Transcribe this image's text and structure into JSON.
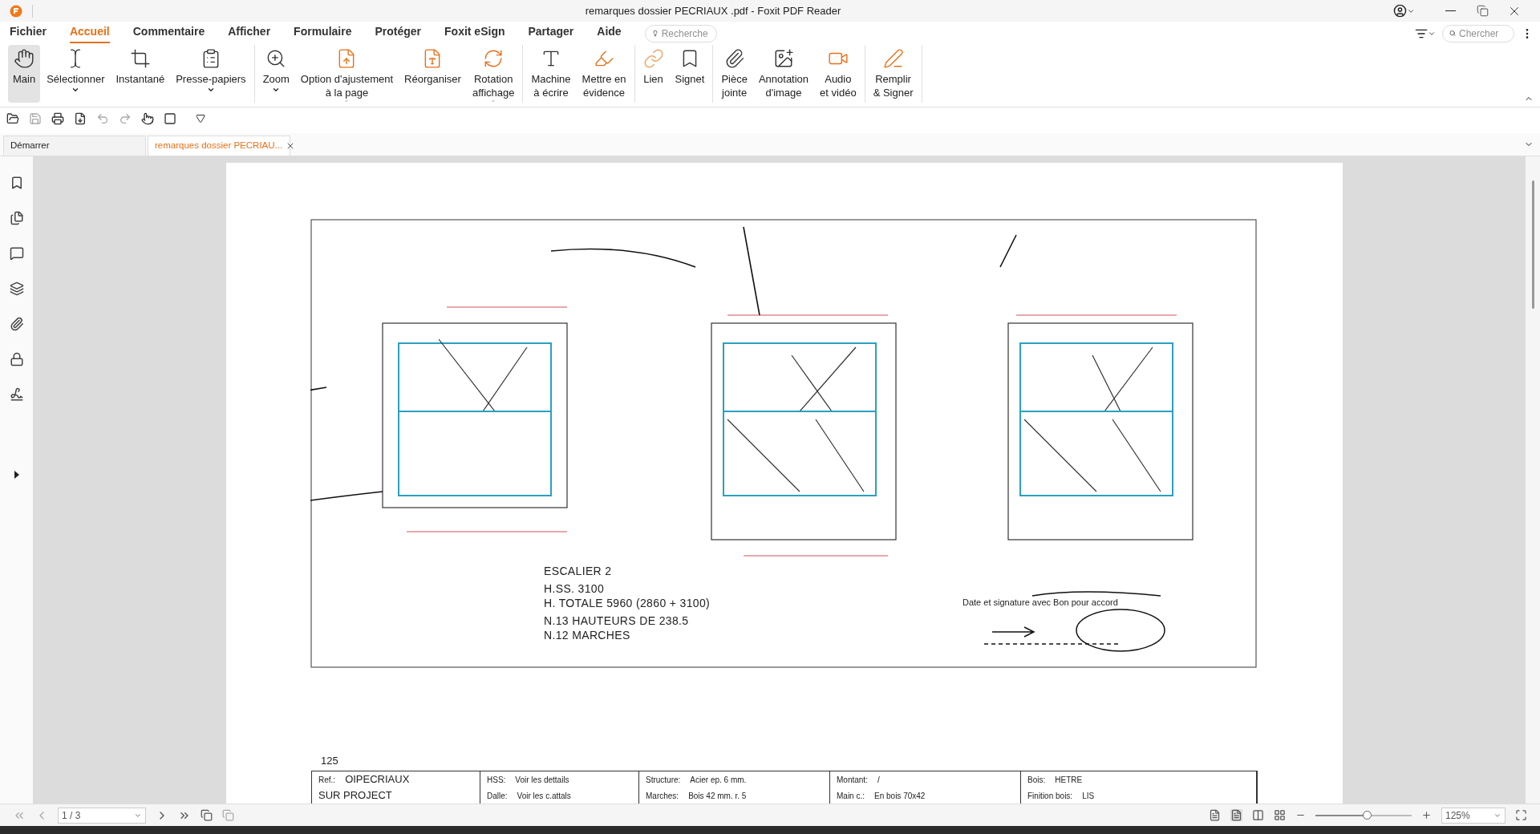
{
  "window": {
    "title": "remarques dossier PECRIAUX .pdf - Foxit PDF Reader"
  },
  "menu": [
    {
      "label": "Fichier",
      "selected": false
    },
    {
      "label": "Accueil",
      "selected": true
    },
    {
      "label": "Commentaire",
      "selected": false
    },
    {
      "label": "Afficher",
      "selected": false
    },
    {
      "label": "Formulaire",
      "selected": false
    },
    {
      "label": "Protéger",
      "selected": false
    },
    {
      "label": "Foxit eSign",
      "selected": false
    },
    {
      "label": "Partager",
      "selected": false
    },
    {
      "label": "Aide",
      "selected": false
    }
  ],
  "menu_search": {
    "placeholder": "Recherche"
  },
  "find": {
    "placeholder": "Chercher"
  },
  "ribbon": [
    [
      {
        "lines": [
          "Main"
        ],
        "selected": true,
        "dropdown": false
      },
      {
        "lines": [
          "Sélectionner"
        ],
        "selected": false,
        "dropdown": true
      },
      {
        "lines": [
          "Instantané"
        ],
        "selected": false,
        "dropdown": false
      },
      {
        "lines": [
          "Presse-papiers"
        ],
        "selected": false,
        "dropdown": true
      }
    ],
    [
      {
        "lines": [
          "Zoom"
        ],
        "selected": false,
        "dropdown": true
      },
      {
        "lines": [
          "Option d'ajustement",
          "à la page"
        ],
        "selected": false,
        "dropdown": true
      },
      {
        "lines": [
          "Réorganiser"
        ],
        "selected": false,
        "dropdown": false
      },
      {
        "lines": [
          "Rotation",
          "affichage"
        ],
        "selected": false,
        "dropdown": true
      }
    ],
    [
      {
        "lines": [
          "Machine",
          "à écrire"
        ],
        "selected": false,
        "dropdown": false
      },
      {
        "lines": [
          "Mettre en",
          "évidence"
        ],
        "selected": false,
        "dropdown": false
      }
    ],
    [
      {
        "lines": [
          "Lien"
        ],
        "selected": false,
        "dropdown": false
      },
      {
        "lines": [
          "Signet"
        ],
        "selected": false,
        "dropdown": false
      }
    ],
    [
      {
        "lines": [
          "Pièce",
          "jointe"
        ],
        "selected": false,
        "dropdown": false
      },
      {
        "lines": [
          "Annotation",
          "d'image"
        ],
        "selected": false,
        "dropdown": false
      },
      {
        "lines": [
          "Audio",
          "et vidéo"
        ],
        "selected": false,
        "dropdown": false
      }
    ],
    [
      {
        "lines": [
          "Remplir",
          "& Signer"
        ],
        "selected": false,
        "dropdown": false
      }
    ]
  ],
  "doc_tabs": [
    {
      "label": "Démarrer",
      "selected": false,
      "closable": false
    },
    {
      "label": "remarques dossier PECRIAU...",
      "selected": true,
      "closable": true
    }
  ],
  "page": {
    "notes": [
      "ESCALIER 2",
      "H.SS. 3100",
      "H. TOTALE 5960 (2860 + 3100)",
      "N.13 HAUTEURS DE 238.5",
      "N.12 MARCHES"
    ],
    "signature_label": "Date et signature avec Bon pour accord",
    "sheet_code": "125",
    "title_block": [
      {
        "label": "Ref.:",
        "value": "OIPECRIAUX"
      },
      {
        "label": "HSS:",
        "value": "Voir les dettails"
      },
      {
        "label": "Structure:",
        "value": "Acier ep. 6 mm."
      },
      {
        "label": "Montant:",
        "value": "/"
      },
      {
        "label": "Bois:",
        "value": "HETRE"
      }
    ],
    "title_block_row_2": [
      {
        "value": "SUR PROJECT"
      },
      {
        "label": "Dalle:",
        "value": "Voir les c.attals"
      },
      {
        "label": "Marches:",
        "value": "Bois 42 mm.   r. 5"
      },
      {
        "label": "Main c.:",
        "value": "En bois 70x42"
      },
      {
        "label": "Finition bois:",
        "value": "LIS"
      }
    ]
  },
  "status": {
    "page": "1 / 3",
    "zoom": "125%",
    "level": 0.53
  }
}
